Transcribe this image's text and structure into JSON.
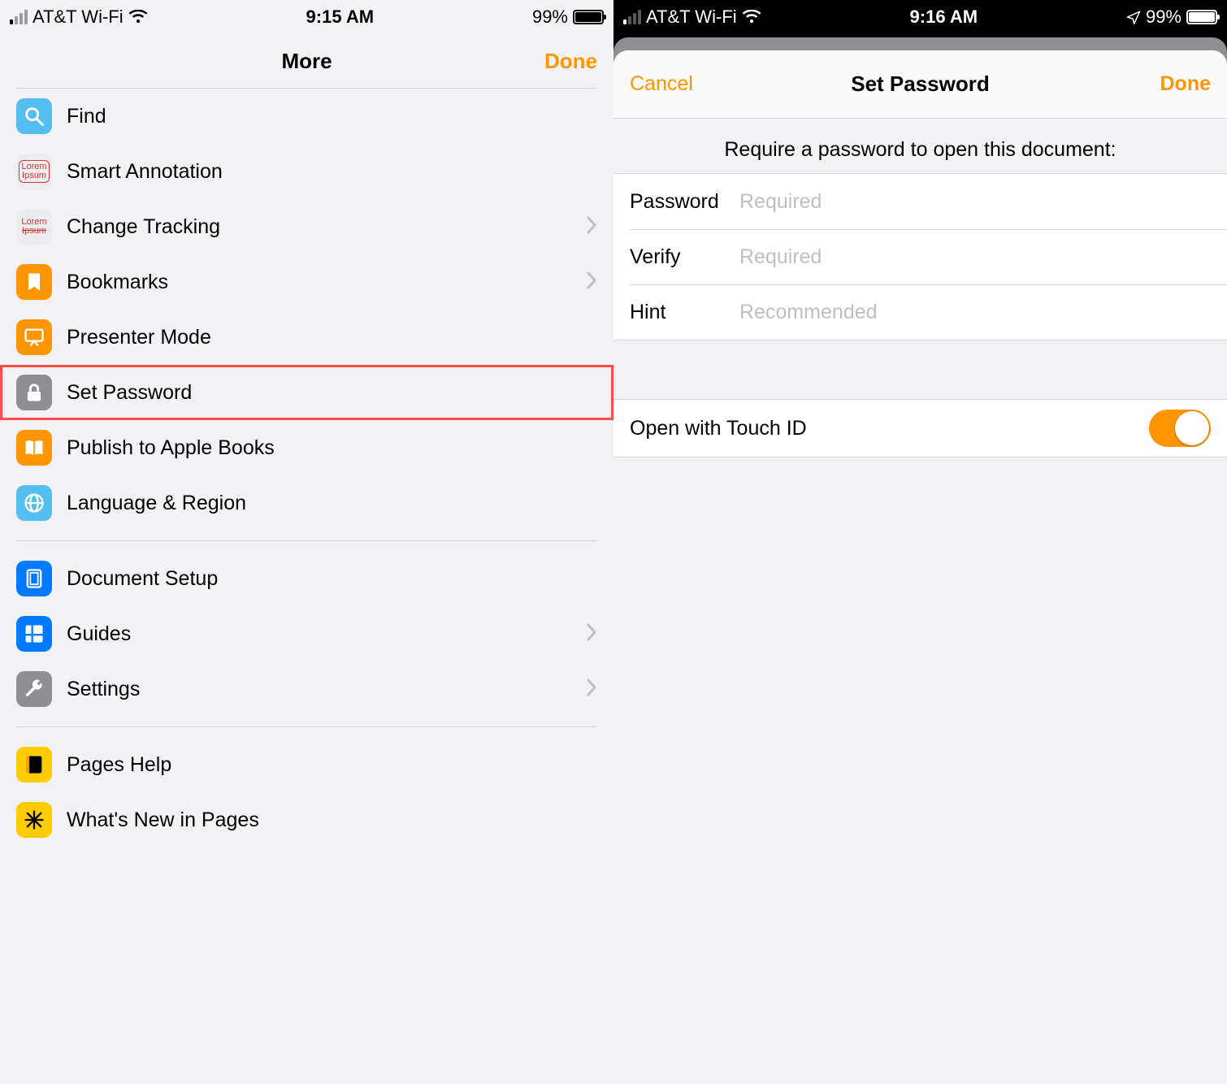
{
  "left": {
    "status": {
      "carrier": "AT&T Wi-Fi",
      "time": "9:15 AM",
      "battery_pct": "99%"
    },
    "header": {
      "title": "More",
      "done": "Done"
    },
    "groups": [
      {
        "items": [
          {
            "id": "find",
            "label": "Find",
            "chevron": false
          },
          {
            "id": "smart-annot",
            "label": "Smart Annotation",
            "chevron": false
          },
          {
            "id": "change-tracking",
            "label": "Change Tracking",
            "chevron": true
          },
          {
            "id": "bookmarks",
            "label": "Bookmarks",
            "chevron": true
          },
          {
            "id": "presenter",
            "label": "Presenter Mode",
            "chevron": false
          },
          {
            "id": "set-password",
            "label": "Set Password",
            "chevron": false,
            "highlight": true
          },
          {
            "id": "publish",
            "label": "Publish to Apple Books",
            "chevron": false
          },
          {
            "id": "lang-region",
            "label": "Language & Region",
            "chevron": false
          }
        ]
      },
      {
        "items": [
          {
            "id": "doc-setup",
            "label": "Document Setup",
            "chevron": false
          },
          {
            "id": "guides",
            "label": "Guides",
            "chevron": true
          },
          {
            "id": "settings",
            "label": "Settings",
            "chevron": true
          }
        ]
      },
      {
        "items": [
          {
            "id": "help",
            "label": "Pages Help",
            "chevron": false
          },
          {
            "id": "whatsnew",
            "label": "What's New in Pages",
            "chevron": false
          }
        ]
      }
    ]
  },
  "right": {
    "status": {
      "carrier": "AT&T Wi-Fi",
      "time": "9:16 AM",
      "battery_pct": "99%"
    },
    "sheet": {
      "cancel": "Cancel",
      "title": "Set Password",
      "done": "Done",
      "caption": "Require a password to open this document:",
      "fields": [
        {
          "id": "password",
          "label": "Password",
          "placeholder": "Required"
        },
        {
          "id": "verify",
          "label": "Verify",
          "placeholder": "Required"
        },
        {
          "id": "hint",
          "label": "Hint",
          "placeholder": "Recommended"
        }
      ],
      "touchid": {
        "label": "Open with Touch ID",
        "on": true
      }
    }
  },
  "icons": {
    "find": {
      "bg": "#55bef0",
      "kind": "search"
    },
    "smart-annot": {
      "bg": "#ededef",
      "kind": "lorem-red"
    },
    "change-tracking": {
      "bg": "#ededef",
      "kind": "lorem-strike"
    },
    "bookmarks": {
      "bg": "#ff9500",
      "kind": "bookmark"
    },
    "presenter": {
      "bg": "#ff9500",
      "kind": "presenter"
    },
    "set-password": {
      "bg": "#8e8e93",
      "kind": "lock"
    },
    "publish": {
      "bg": "#ff9500",
      "kind": "book"
    },
    "lang-region": {
      "bg": "#55bef0",
      "kind": "globe"
    },
    "doc-setup": {
      "bg": "#007aff",
      "kind": "doc"
    },
    "guides": {
      "bg": "#007aff",
      "kind": "guides"
    },
    "settings": {
      "bg": "#8e8e93",
      "kind": "wrench"
    },
    "help": {
      "bg": "#ffcc00",
      "kind": "help-book"
    },
    "whatsnew": {
      "bg": "#ffcc00",
      "kind": "spark"
    }
  }
}
